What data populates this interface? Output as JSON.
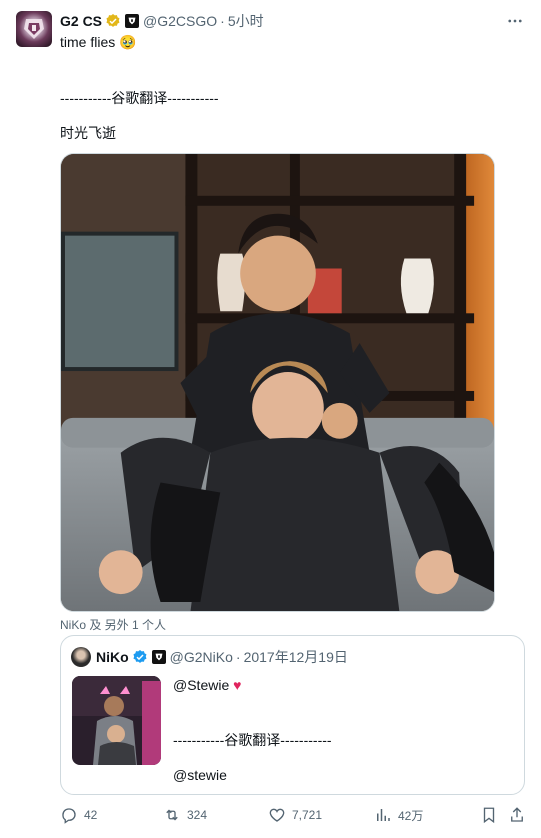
{
  "post": {
    "author_name": "G2 CS",
    "author_handle": "@G2CSGO",
    "time_ago": "5小时",
    "text": "time flies 🥹",
    "divider": "-----------谷歌翻译-----------",
    "translation": "时光飞逝",
    "tagged": "NiKo 及 另外 1 个人"
  },
  "quote": {
    "author_name": "NiKo",
    "author_handle": "@G2NiKo",
    "date": "2017年12月19日",
    "line1": "@Stewie",
    "heart": "♥",
    "divider": "-----------谷歌翻译-----------",
    "line2": "@stewie"
  },
  "actions": {
    "replies": "42",
    "reposts": "324",
    "likes": "7,721",
    "views": "42万"
  },
  "colors": {
    "text": "#0f1419",
    "secondary": "#536471",
    "border": "#cfd9de",
    "verified_gold": "#e2b719",
    "verified_blue": "#1d9bf0",
    "heart": "#e0245e"
  }
}
